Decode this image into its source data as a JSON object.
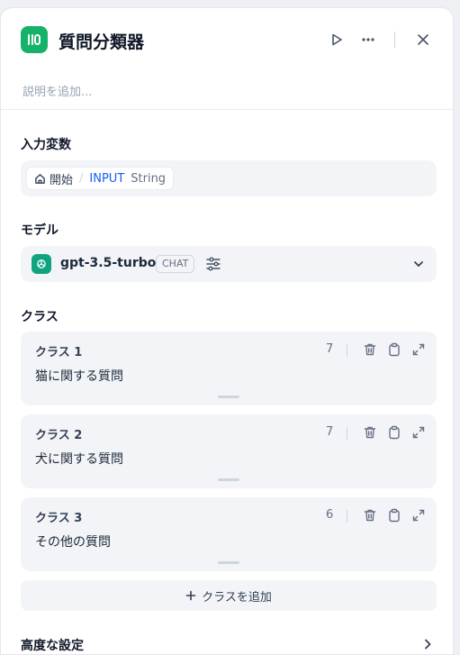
{
  "header": {
    "title": "質問分類器",
    "description_placeholder": "説明を追加...",
    "accent_color": "#17b26a"
  },
  "input_variables": {
    "label": "入力変数",
    "chip": {
      "node": "開始",
      "separator": "/",
      "variable": "INPUT",
      "type": "String"
    }
  },
  "model": {
    "label": "モデル",
    "name": "gpt-3.5-turbo",
    "badge": "CHAT",
    "logo_color": "#10a37f"
  },
  "classes": {
    "label": "クラス",
    "items": [
      {
        "name": "クラス 1",
        "text": "猫に関する質問",
        "count": "7"
      },
      {
        "name": "クラス 2",
        "text": "犬に関する質問",
        "count": "7"
      },
      {
        "name": "クラス 3",
        "text": "その他の質問",
        "count": "6"
      }
    ],
    "add_label": "クラスを追加"
  },
  "advanced": {
    "label": "高度な設定"
  }
}
